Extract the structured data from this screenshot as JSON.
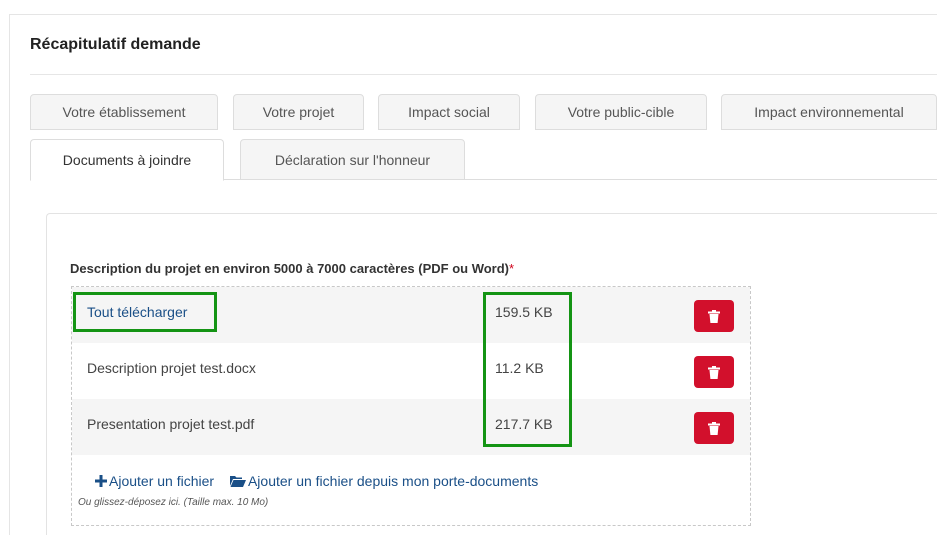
{
  "page": {
    "title": "Récapitulatif demande"
  },
  "tabs": [
    {
      "label": "Votre établissement"
    },
    {
      "label": "Votre projet"
    },
    {
      "label": "Impact social"
    },
    {
      "label": "Votre public-cible"
    },
    {
      "label": "Impact environnemental"
    },
    {
      "label": "Documents à joindre",
      "active": true
    },
    {
      "label": "Déclaration sur l'honneur"
    }
  ],
  "field": {
    "label": "Description du projet en environ 5000 à 7000 caractères (PDF ou Word)",
    "required_mark": "*"
  },
  "files": [
    {
      "name": "Tout télécharger",
      "size": "159.5 KB",
      "is_link": true
    },
    {
      "name": "Description projet test.docx",
      "size": "11.2 KB"
    },
    {
      "name": "Presentation projet test.pdf",
      "size": "217.7 KB"
    }
  ],
  "icons": {
    "delete": "trash-icon",
    "add": "plus-icon",
    "folder": "folder-open-icon"
  },
  "actions": {
    "add_file": "Ajouter un fichier",
    "add_from_folder": "Ajouter un fichier depuis mon porte-documents"
  },
  "hint": "Ou glissez-déposez ici. (Taille max. 10 Mo)",
  "colors": {
    "delete": "#d2102c",
    "link": "#1a4f87",
    "highlight": "#149414"
  }
}
